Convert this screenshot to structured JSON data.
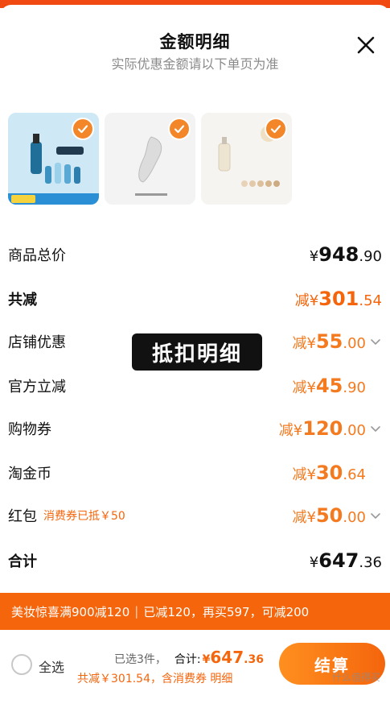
{
  "header": {
    "title": "金额明细",
    "subtitle": "实际优惠金额请以下单页为准"
  },
  "products": [
    {
      "name": "product-1"
    },
    {
      "name": "product-2"
    },
    {
      "name": "product-3"
    }
  ],
  "rows": {
    "total": {
      "label": "商品总价",
      "prefix": "¥",
      "int": "948",
      "dec": ".90"
    },
    "reduce": {
      "label": "共减",
      "prefix": "减¥",
      "int": "301",
      "dec": ".54"
    },
    "shop": {
      "label": "店铺优惠",
      "prefix": "减¥",
      "int": "55",
      "dec": ".00"
    },
    "official": {
      "label": "官方立减",
      "prefix": "减¥",
      "int": "45",
      "dec": ".90"
    },
    "coupon": {
      "label": "购物券",
      "prefix": "减¥",
      "int": "120",
      "dec": ".00"
    },
    "coins": {
      "label": "淘金币",
      "prefix": "减¥",
      "int": "30",
      "dec": ".64"
    },
    "redpacket": {
      "label": "红包",
      "note": "消费券已抵￥50",
      "prefix": "减¥",
      "int": "50",
      "dec": ".00"
    },
    "sum": {
      "label": "合计",
      "prefix": "¥",
      "int": "647",
      "dec": ".36"
    }
  },
  "overlay": "抵扣明细",
  "promo": {
    "part1": "美妆惊喜满900减120",
    "sep": "|",
    "part2": "已减120，再买597，可减200"
  },
  "footer": {
    "select_all": "全选",
    "count": "已选3件，",
    "sum_label": "合计:",
    "sum_prefix": "¥",
    "sum_int": "647",
    "sum_dec": ".36",
    "discount_line": "共减￥301.54，含消费券 明细",
    "checkout": "结算",
    "watermark": "什么值得买"
  },
  "colors": {
    "accent": "#f4650c",
    "promo_bg": "#f4650c"
  }
}
